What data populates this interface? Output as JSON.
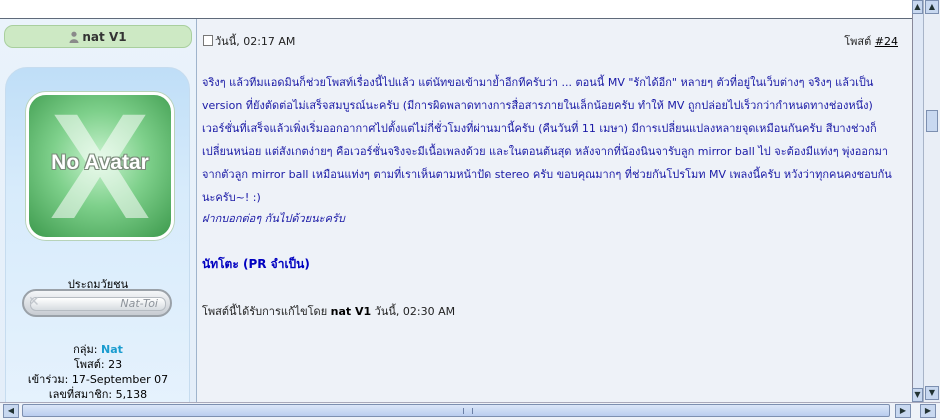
{
  "user": {
    "name": "nat V1",
    "avatar_text": "No Avatar",
    "rank_title": "ประถมวัยชน",
    "rank_badge_text": "Nat-Toi"
  },
  "stats": {
    "group_label": "กลุ่ม:",
    "group_value": "Nat",
    "posts_label": "โพสต์:",
    "posts_value": "23",
    "joined_label": "เข้าร่วม:",
    "joined_value": "17-September 07",
    "member_label": "เลขที่สมาชิก:",
    "member_value": "5,138"
  },
  "post": {
    "timestamp": "วันนี้, 02:17 AM",
    "post_label": "โพสต์",
    "post_number": "#24",
    "body": "จริงๆ แล้วทีมแอดมินก็ช่วยโพสท์เรื่องนี้ไปแล้ว แต่นัทขอเข้ามาย้ำอีกทีครับว่า ... ตอนนี้ MV \"รักได้อีก\" หลายๆ ตัวที่อยู่ในเว็บต่างๆ จริงๆ แล้วเป็น version ที่ยังตัดต่อไม่เสร็จสมบูรณ์นะครับ (มีการผิดพลาดทางการสื่อสารภายในเล็กน้อยครับ ทำให้ MV ถูกปล่อยไปเร็วกว่ากำหนดทางช่องหนึ่ง) เวอร์ชั่นที่เสร็จแล้วเพิ่งเริ่มออกอากาศไปตั้งแต่ไม่กี่ชั่วโมงที่ผ่านมานี้ครับ (คืนวันที่ 11 เมษา) มีการเปลี่ยนแปลงหลายจุดเหมือนกันครับ สีบางช่วงก็เปลี่ยนหน่อย แต่สังเกตง่ายๆ คือเวอร์ชั่นจริงจะมีเนื้อเพลงด้วย และในตอนต้นสุด หลังจากที่น้องนินจารับลูก mirror ball ไป จะต้องมีแท่งๆ พุ่งออกมาจากตัวลูก mirror ball เหมือนแท่งๆ ตามที่เราเห็นตามหน้าปัด stereo ครับ ขอบคุณมากๆ ที่ช่วยกันโปรโมท MV เพลงนี้ครับ หวังว่าทุกคนคงชอบกันนะครับ~! :)",
    "signature_italic": "ฝากบอกต่อๆ กันไปด้วยนะครับ",
    "signature_bold": "นัทโตะ (PR จำเป็น)",
    "edit_prefix": "โพสต์นี้ได้รับการแก้ไขโดย",
    "edit_user": "nat V1",
    "edit_time": "วันนี้, 02:30 AM"
  },
  "colors": {
    "link_blue": "#1a1aa6",
    "group_color": "#1a9ccf",
    "avatar_green": "#7ed08b"
  },
  "icons": {
    "user": "user-icon",
    "post": "document-icon"
  }
}
